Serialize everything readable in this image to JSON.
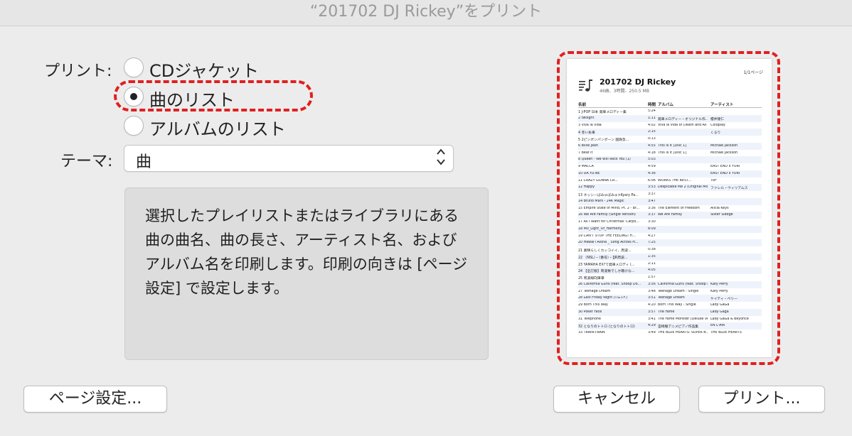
{
  "window": {
    "title": "“201702 DJ Rickey”をプリント"
  },
  "print_section": {
    "label": "プリント:",
    "options": [
      {
        "label": "CDジャケット",
        "selected": false
      },
      {
        "label": "曲のリスト",
        "selected": true
      },
      {
        "label": "アルバムのリスト",
        "selected": false
      }
    ]
  },
  "theme": {
    "label": "テーマ:",
    "value": "曲"
  },
  "description": "選択したプレイリストまたはライブラリにある曲の曲名、曲の長さ、アーティスト名、およびアルバム名を印刷します。印刷の向きは [ページ設定] で設定します。",
  "buttons": {
    "page_setup": "ページ設定...",
    "cancel": "キャンセル",
    "print": "プリント..."
  },
  "preview": {
    "page_indicator": "1/1ページ",
    "playlist_title": "201702 DJ Rickey",
    "playlist_subtitle": "46曲、3時間、250.5 MB",
    "headers": {
      "name": "名前",
      "time": "時間",
      "album": "アルバム",
      "artist": "アーティスト"
    },
    "rows": [
      {
        "name": "1 J-POP 日本 発車メロディー集",
        "time": "5:24",
        "album": "",
        "artist": ""
      },
      {
        "name": "2 twilight",
        "time": "1:11",
        "album": "発車メロディー・オリジナル作...",
        "artist": "櫻井隆仁"
      },
      {
        "name": "3 Viva la Vida",
        "time": "4:02",
        "album": "Viva la Vida or Death and All H...",
        "artist": "Coldplay"
      },
      {
        "name": "4 赤い糸車",
        "time": "2:15",
        "album": "",
        "artist": "くるり"
      },
      {
        "name": "5 2ピンポンパンポーン 国鉄急...",
        "time": "0:13",
        "album": "",
        "artist": ""
      },
      {
        "name": "6 Billie Jean",
        "time": "4:55",
        "album": "This Is It [Disc 1]",
        "artist": "Michael Jackson"
      },
      {
        "name": "7 Beat It",
        "time": "4:18",
        "album": "This Is It [Disc 1]",
        "artist": "Michael Jackson"
      },
      {
        "name": "8 Queen - We Will Rock You (1)",
        "time": "5:03",
        "album": "",
        "artist": ""
      },
      {
        "name": "9 MACCA",
        "time": "4:59",
        "album": "",
        "artist": "EAST END x YURI"
      },
      {
        "name": "10 DA.YO.NE",
        "time": "4:36",
        "album": "",
        "artist": "EAST END x YURI"
      },
      {
        "name": "11 CRAZY GONNA CR...",
        "time": "6:06",
        "album": "WORKS THE BEST...",
        "artist": "TRF"
      },
      {
        "name": "12 Happy",
        "time": "3:53",
        "album": "Despicable Me 2 (Original Mot...",
        "artist": "ファレル・ウィリアムス"
      },
      {
        "name": "13 ネッシーばみゅばみゅ×Kyary Pa...",
        "time": "3:37",
        "album": "",
        "artist": ""
      },
      {
        "name": "14 Bruno Mars - 24K Magic",
        "time": "3:47",
        "album": "",
        "artist": ""
      },
      {
        "name": "15 Empire State of Mind, Pt. 2 - Br...",
        "time": "3:36",
        "album": "The Element of Freedom",
        "artist": "Alicia Keys"
      },
      {
        "name": "16 We Are Family (Single Version)",
        "time": "3:37",
        "album": "We Are Family",
        "artist": "Sister Sledge"
      },
      {
        "name": "17 All I Want for Christmas' Carpo...",
        "time": "3:30",
        "album": "",
        "artist": ""
      },
      {
        "name": "18 M0_Light_Of_Harmony",
        "time": "8:09",
        "album": "",
        "artist": ""
      },
      {
        "name": "19 CAN'T STOP THE FEELING! Fi...",
        "time": "4:27",
        "album": "",
        "artist": ""
      },
      {
        "name": "20 Hawai'i Aloha _ Song Across H...",
        "time": "7:25",
        "album": "",
        "artist": ""
      },
      {
        "name": "21 素晴らしくカッコイイ、周波...",
        "time": "0:38",
        "album": "",
        "artist": ""
      },
      {
        "name": "22 〈NSL〉・〈番号〉・【JR周波...",
        "time": "1:35",
        "album": "",
        "artist": ""
      },
      {
        "name": "23 YAMAHA EX?で発車メロディ (...",
        "time": "2:11",
        "album": "",
        "artist": ""
      },
      {
        "name": "24 【全訂版】周波数でしか聴けな...",
        "time": "4:05",
        "album": "",
        "artist": ""
      },
      {
        "name": "25 周波線DJ車掌",
        "time": "1:57",
        "album": "",
        "artist": ""
      },
      {
        "name": "26 California Gurls (feat. Snoop Do...",
        "time": "3:56",
        "album": "California Gurls (feat. Snoop Do...",
        "artist": "Katy Perry"
      },
      {
        "name": "27 Teenage Dream",
        "time": "3:48",
        "album": "Teenage Dream - Single",
        "artist": "Katy Perry"
      },
      {
        "name": "28 Last Friday Night (T.G.I.F.)",
        "time": "3:51",
        "album": "Teenage Dream",
        "artist": "ケイティ・ペリー"
      },
      {
        "name": "29 Born This Way",
        "time": "4:20",
        "album": "Born This Way - Single",
        "artist": "Lady GaGa"
      },
      {
        "name": "30 Poker Face",
        "time": "3:57",
        "album": "The Fame",
        "artist": "Lady Gaga"
      },
      {
        "name": "31 Telephone",
        "time": "3:41",
        "album": "The Fame Monster (Deluxe Ver...",
        "artist": "Lady GaGa & Beyoncé"
      },
      {
        "name": "32 となりのトトロ (となりのトトロ)",
        "time": "4:29",
        "album": "宮崎駿アニメピアノ作品集",
        "artist": "EN L'AIR"
      },
      {
        "name": "33 TRAIN-TRAIN",
        "time": "3:49",
        "album": "THE BLUE HEARTS: SUPER B...",
        "artist": "THE BLUE HEARTS"
      }
    ]
  }
}
